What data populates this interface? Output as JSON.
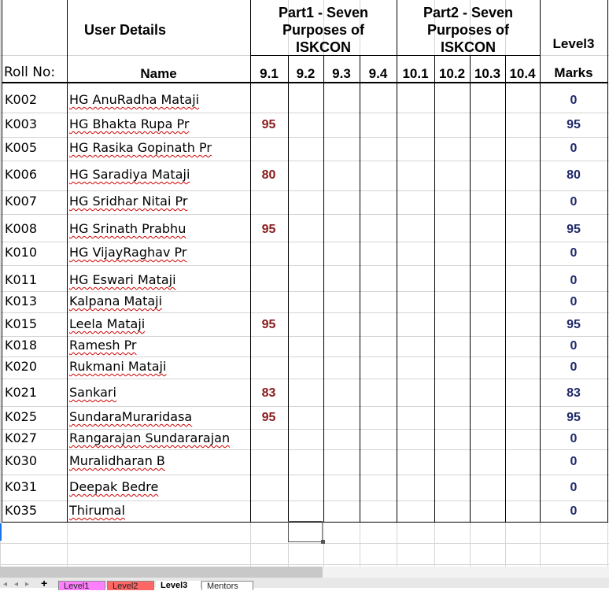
{
  "header": {
    "user_details": "User Details",
    "part1_line1": "Part1 - Seven",
    "part1_line2": "Purposes of",
    "part1_line3": "ISKCON",
    "part2_line1": "Part2 - Seven",
    "part2_line2": "Purposes of",
    "part2_line3": "ISKCON",
    "level3": "Level3",
    "roll_no": "Roll No:",
    "name": "Name",
    "cols": [
      "9.1",
      "9.2",
      "9.3",
      "9.4",
      "10.1",
      "10.2",
      "10.3",
      "10.4"
    ],
    "marks": "Marks"
  },
  "rows": [
    {
      "roll": "K002",
      "name": "HG AnuRadha Mataji",
      "score": "",
      "marks": "0"
    },
    {
      "roll": "K003",
      "name": "HG Bhakta Rupa Pr",
      "score": "95",
      "marks": "95"
    },
    {
      "roll": "K005",
      "name": "HG Rasika Gopinath Pr",
      "score": "",
      "marks": "0"
    },
    {
      "roll": "K006",
      "name": "HG Saradiya Mataji",
      "score": "80",
      "marks": "80"
    },
    {
      "roll": "K007",
      "name": "HG Sridhar Nitai Pr",
      "score": "",
      "marks": "0"
    },
    {
      "roll": "K008",
      "name": "HG Srinath Prabhu",
      "score": "95",
      "marks": "95"
    },
    {
      "roll": "K010",
      "name": "HG VijayRaghav Pr",
      "score": "",
      "marks": "0"
    },
    {
      "roll": "K011",
      "name": "HG Eswari Mataji",
      "score": "",
      "marks": "0"
    },
    {
      "roll": "K013",
      "name": "Kalpana Mataji",
      "score": "",
      "marks": "0"
    },
    {
      "roll": "K015",
      "name": "Leela Mataji",
      "score": "95",
      "marks": "95"
    },
    {
      "roll": "K018",
      "name": "Ramesh Pr",
      "score": "",
      "marks": "0"
    },
    {
      "roll": "K020",
      "name": "Rukmani Mataji",
      "score": "",
      "marks": "0"
    },
    {
      "roll": "K021",
      "name": "Sankari",
      "score": "83",
      "marks": "83"
    },
    {
      "roll": "K025",
      "name": "SundaraMuraridasa",
      "score": "95",
      "marks": "95"
    },
    {
      "roll": "K027",
      "name": "Rangarajan Sundararajan",
      "score": "",
      "marks": "0"
    },
    {
      "roll": "K030",
      "name": "Muralidharan B",
      "score": "",
      "marks": "0"
    },
    {
      "roll": "K031",
      "name": "Deepak Bedre",
      "score": "",
      "marks": "0"
    },
    {
      "roll": "K035",
      "name": "Thirumal",
      "score": "",
      "marks": "0"
    }
  ],
  "sheet_tabs": [
    {
      "label": "Level1",
      "color": "#ff80ff"
    },
    {
      "label": "Level2",
      "color": "#ff6666"
    },
    {
      "label": "Level3",
      "color": "#ffffff",
      "active": true
    },
    {
      "label": "Mentors",
      "color": "#ffffff"
    }
  ],
  "colors": {
    "score_text": "#8b1a1a",
    "marks_text": "#1f2a6b",
    "spellcheck": "#d00000"
  }
}
